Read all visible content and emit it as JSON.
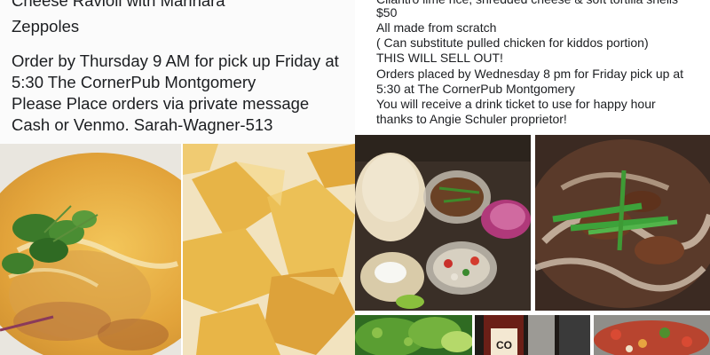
{
  "left_post": {
    "lines": [
      "Cheese Ravioli with Marinara",
      "Zeppoles",
      "Order by Thursday 9 AM for pick up Friday at",
      "5:30 The CornerPub Montgomery",
      "Please Place orders via private message",
      "Cash or Venmo. Sarah-Wagner-513"
    ]
  },
  "right_post": {
    "lines": [
      "Cilantro lime rice, shredded cheese & soft tortilla shells",
      "$50",
      "All made from scratch",
      "( Can substitute pulled chicken for kiddos portion)",
      "THIS WILL SELL OUT!",
      "Orders placed by Wednesday 8 pm for Friday pick up at",
      "5:30 at The CornerPub Montgomery",
      "You will receive a drink ticket to use for happy hour",
      "thanks to Angie Schuler proprietor!"
    ]
  },
  "photos": {
    "soup": "ravioli-soup-photo",
    "zeppoles": "zeppoles-photo",
    "taco_kit": "taco-kit-photo",
    "meat_onions": "meat-onions-photo",
    "guacamole": "guacamole-photo",
    "hot_sauce": "hot-sauce-photo",
    "salsa": "salsa-photo"
  }
}
